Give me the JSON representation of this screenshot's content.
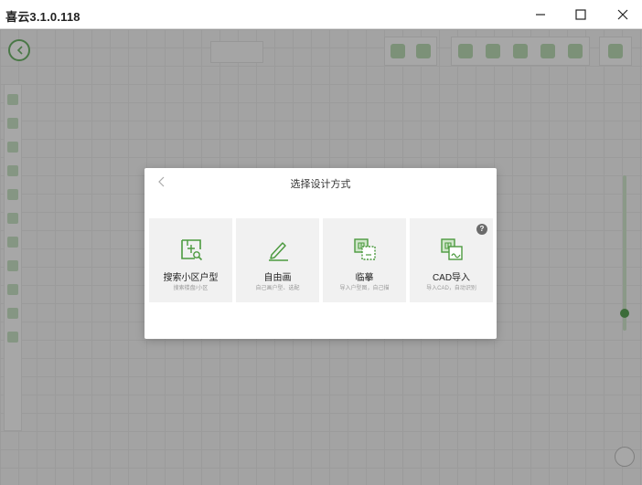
{
  "window": {
    "title": "喜云3.1.0.118"
  },
  "dialog": {
    "title": "选择设计方式",
    "options": [
      {
        "name": "搜索小区户型",
        "desc": "搜索楼盘/小区",
        "icon": "search-floorplan-icon"
      },
      {
        "name": "自由画",
        "desc": "自己画户型、选配",
        "icon": "pencil-draw-icon"
      },
      {
        "name": "临摹",
        "desc": "导入户型图，自己描",
        "icon": "trace-image-icon"
      },
      {
        "name": "CAD导入",
        "desc": "导入CAD，自动识别",
        "icon": "cad-import-icon",
        "help": "?"
      }
    ]
  },
  "colors": {
    "accent": "#5aa255",
    "icon_green": "#4c9a3f",
    "overlay": "rgba(0,0,0,0.33)"
  }
}
